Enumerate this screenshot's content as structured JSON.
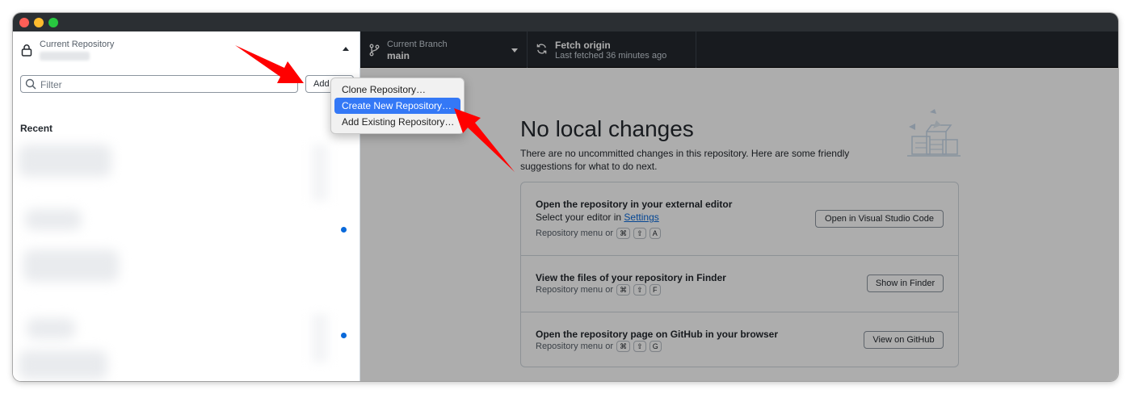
{
  "sidebar": {
    "current_repository_label": "Current Repository",
    "filter_placeholder": "Filter",
    "add_label": "Add",
    "recent_label": "Recent"
  },
  "toolbar": {
    "branch_label": "Current Branch",
    "branch_value": "main",
    "fetch_title": "Fetch origin",
    "fetch_subtitle": "Last fetched 36 minutes ago"
  },
  "menu": {
    "items": [
      {
        "label": "Clone Repository…"
      },
      {
        "label": "Create New Repository…",
        "active": true
      },
      {
        "label": "Add Existing Repository…"
      }
    ]
  },
  "main": {
    "title": "No local changes",
    "subtitle": "There are no uncommitted changes in this repository. Here are some friendly suggestions for what to do next.",
    "cards": [
      {
        "title": "Open the repository in your external editor",
        "sub_prefix": "Select your editor in ",
        "sub_link": "Settings",
        "hint": "Repository menu or",
        "keys": [
          "⌘",
          "⇧",
          "A"
        ],
        "button": "Open in Visual Studio Code"
      },
      {
        "title": "View the files of your repository in Finder",
        "hint": "Repository menu or",
        "keys": [
          "⌘",
          "⇧",
          "F"
        ],
        "button": "Show in Finder"
      },
      {
        "title": "Open the repository page on GitHub in your browser",
        "hint": "Repository menu or",
        "keys": [
          "⌘",
          "⇧",
          "G"
        ],
        "button": "View on GitHub"
      }
    ]
  },
  "colors": {
    "toolbar_bg": "#24292f",
    "accent_blue": "#0969da",
    "menu_highlight": "#3478f6",
    "annotation_red": "#ff0000"
  }
}
